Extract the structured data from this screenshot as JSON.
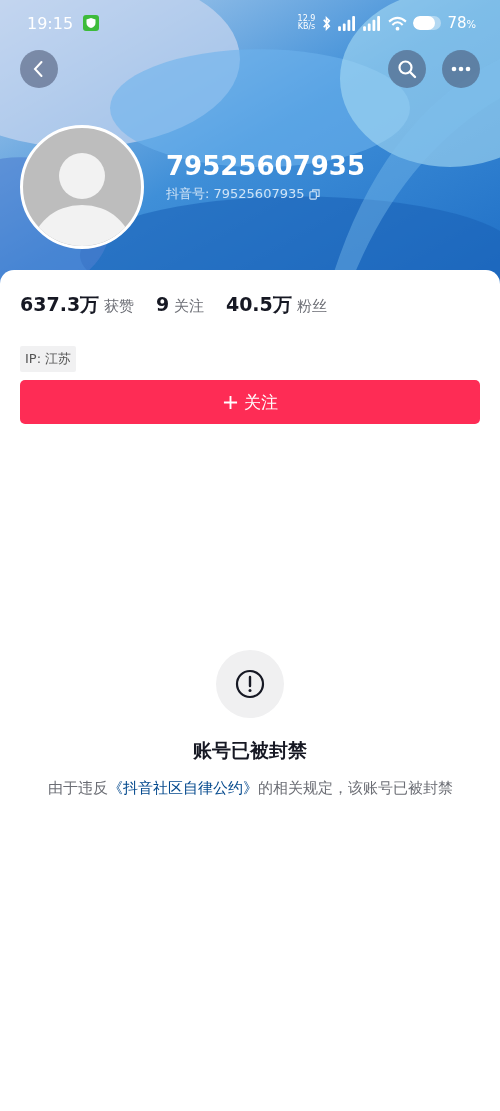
{
  "status_bar": {
    "time": "19:15",
    "net_speed": "12.9",
    "net_unit": "KB/s",
    "battery": "78",
    "battery_unit": "%"
  },
  "profile": {
    "name": "79525607935",
    "id_label": "抖音号: 79525607935"
  },
  "stats": [
    "**637.3万** 获赞",
    "**9** 关注",
    "**40.5万** 粉丝"
  ],
  "ip_tag": "IP: 江苏",
  "follow_button": "关注",
  "notice": {
    "title": "账号已被封禁",
    "text_before": "由于违反",
    "link": "《抖音社区自律公约》",
    "text_after": "的相关规定，该账号已被封禁"
  }
}
